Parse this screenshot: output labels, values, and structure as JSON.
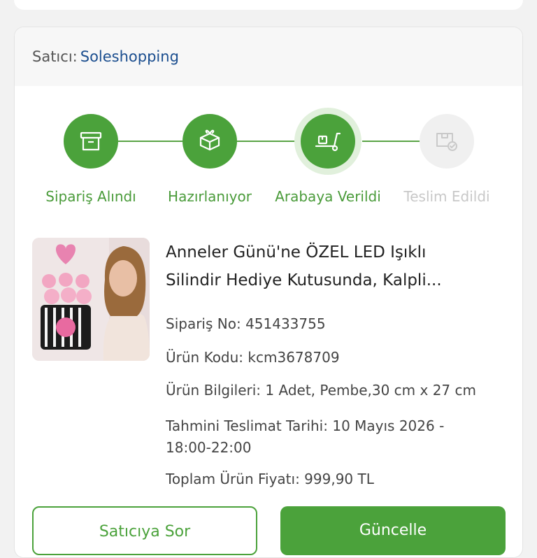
{
  "seller": {
    "label": "Satıcı:",
    "name": "Soleshopping"
  },
  "steps": [
    {
      "label": "Sipariş Alındı",
      "icon": "archive-box-icon",
      "state": "done"
    },
    {
      "label": "Hazırlanıyor",
      "icon": "gift-box-icon",
      "state": "done"
    },
    {
      "label": "Arabaya Verildi",
      "icon": "hand-truck-icon",
      "state": "current"
    },
    {
      "label": "Teslim Edildi",
      "icon": "delivered-box-icon",
      "state": "pending"
    }
  ],
  "product": {
    "title_line1": "Anneler Günü'ne ÖZEL LED Işıklı",
    "title_line2": "Silindir Hediye Kutusunda, Kalpli...",
    "order_no_label": "Sipariş No:",
    "order_no": "451433755",
    "code_label": "Ürün Kodu:",
    "code": "kcm3678709",
    "info_label": "Ürün Bilgileri:",
    "info": "1 Adet, Pembe,30 cm x 27 cm",
    "delivery_label": "Tahmini Teslimat Tarihi:",
    "delivery_date": "10 Mayıs 2026 -",
    "delivery_time": "18:00-22:00",
    "price_label": "Toplam Ürün Fiyatı:",
    "price": "999,90 TL"
  },
  "actions": {
    "ask_seller": "Satıcıya Sor",
    "update": "Güncelle"
  },
  "colors": {
    "green": "#4ba23b",
    "seller_blue": "#1b4e8f",
    "inactive": "#c8c8c8"
  }
}
